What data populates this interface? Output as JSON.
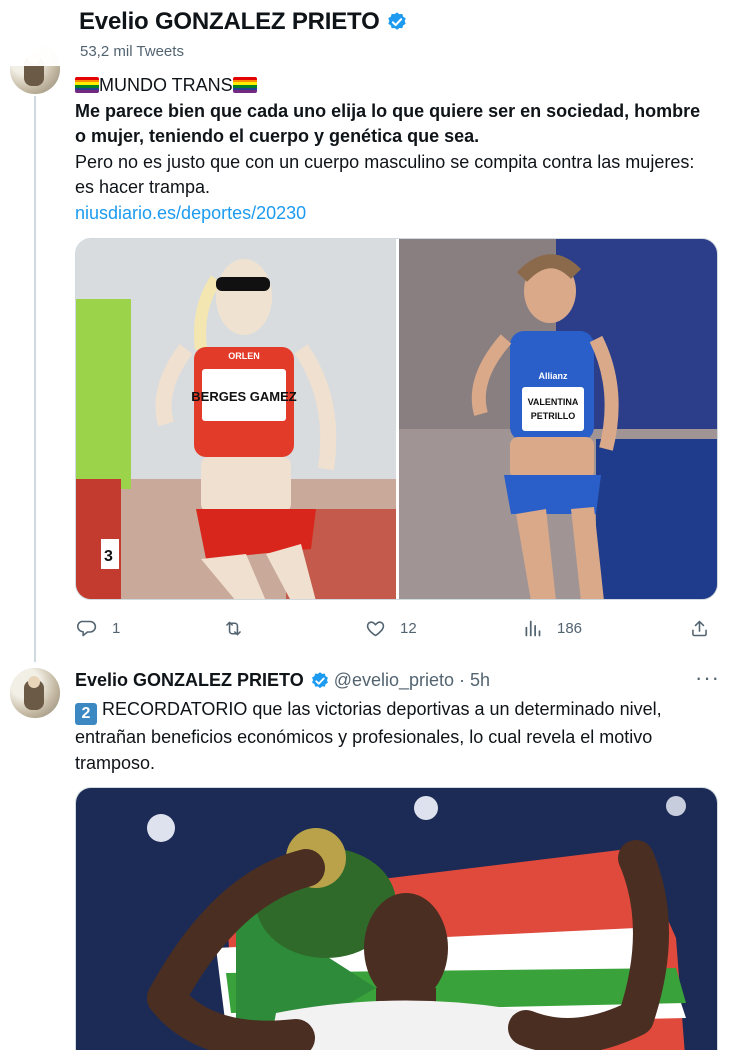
{
  "header": {
    "title": "Evelio GONZALEZ PRIETO",
    "tweet_count": "53,2 mil Tweets"
  },
  "tweet1": {
    "heading": "MUNDO TRANS",
    "bold_text": "Me parece bien que cada uno elija lo que quiere ser en sociedad, hombre o mujer, teniendo el cuerpo y genética que sea.",
    "text": "Pero no es justo que con un cuerpo masculino se compita contra las mujeres: es hacer trampa.",
    "link": "niusdiario.es/deportes/20230",
    "left_bib": "BERGES GAMEZ",
    "left_sponsor": "ORLEN",
    "right_sponsor": "Allianz",
    "right_bib_line1": "VALENTINA",
    "right_bib_line2": "PETRILLO",
    "side_number": "3",
    "actions": {
      "replies": "1",
      "retweets": "",
      "likes": "12",
      "views": "186"
    }
  },
  "tweet2": {
    "name": "Evelio GONZALEZ PRIETO",
    "handle": "@evelio_prieto · 5h",
    "keycap": "2",
    "text": "RECORDATORIO que las victorias deportivas a un determinado nivel, entrañan beneficios económicos y profesionales, lo cual revela el motivo tramposo."
  },
  "colors": {
    "link": "#1d9bf0",
    "verified": "#1d9bf0",
    "secondary_text": "#536471",
    "thread_line": "#cfd9de"
  },
  "icons": [
    "verified-badge-icon",
    "rainbow-flag-icon",
    "reply-icon",
    "retweet-icon",
    "like-icon",
    "views-icon",
    "share-icon",
    "more-icon",
    "keycap-2-icon"
  ]
}
